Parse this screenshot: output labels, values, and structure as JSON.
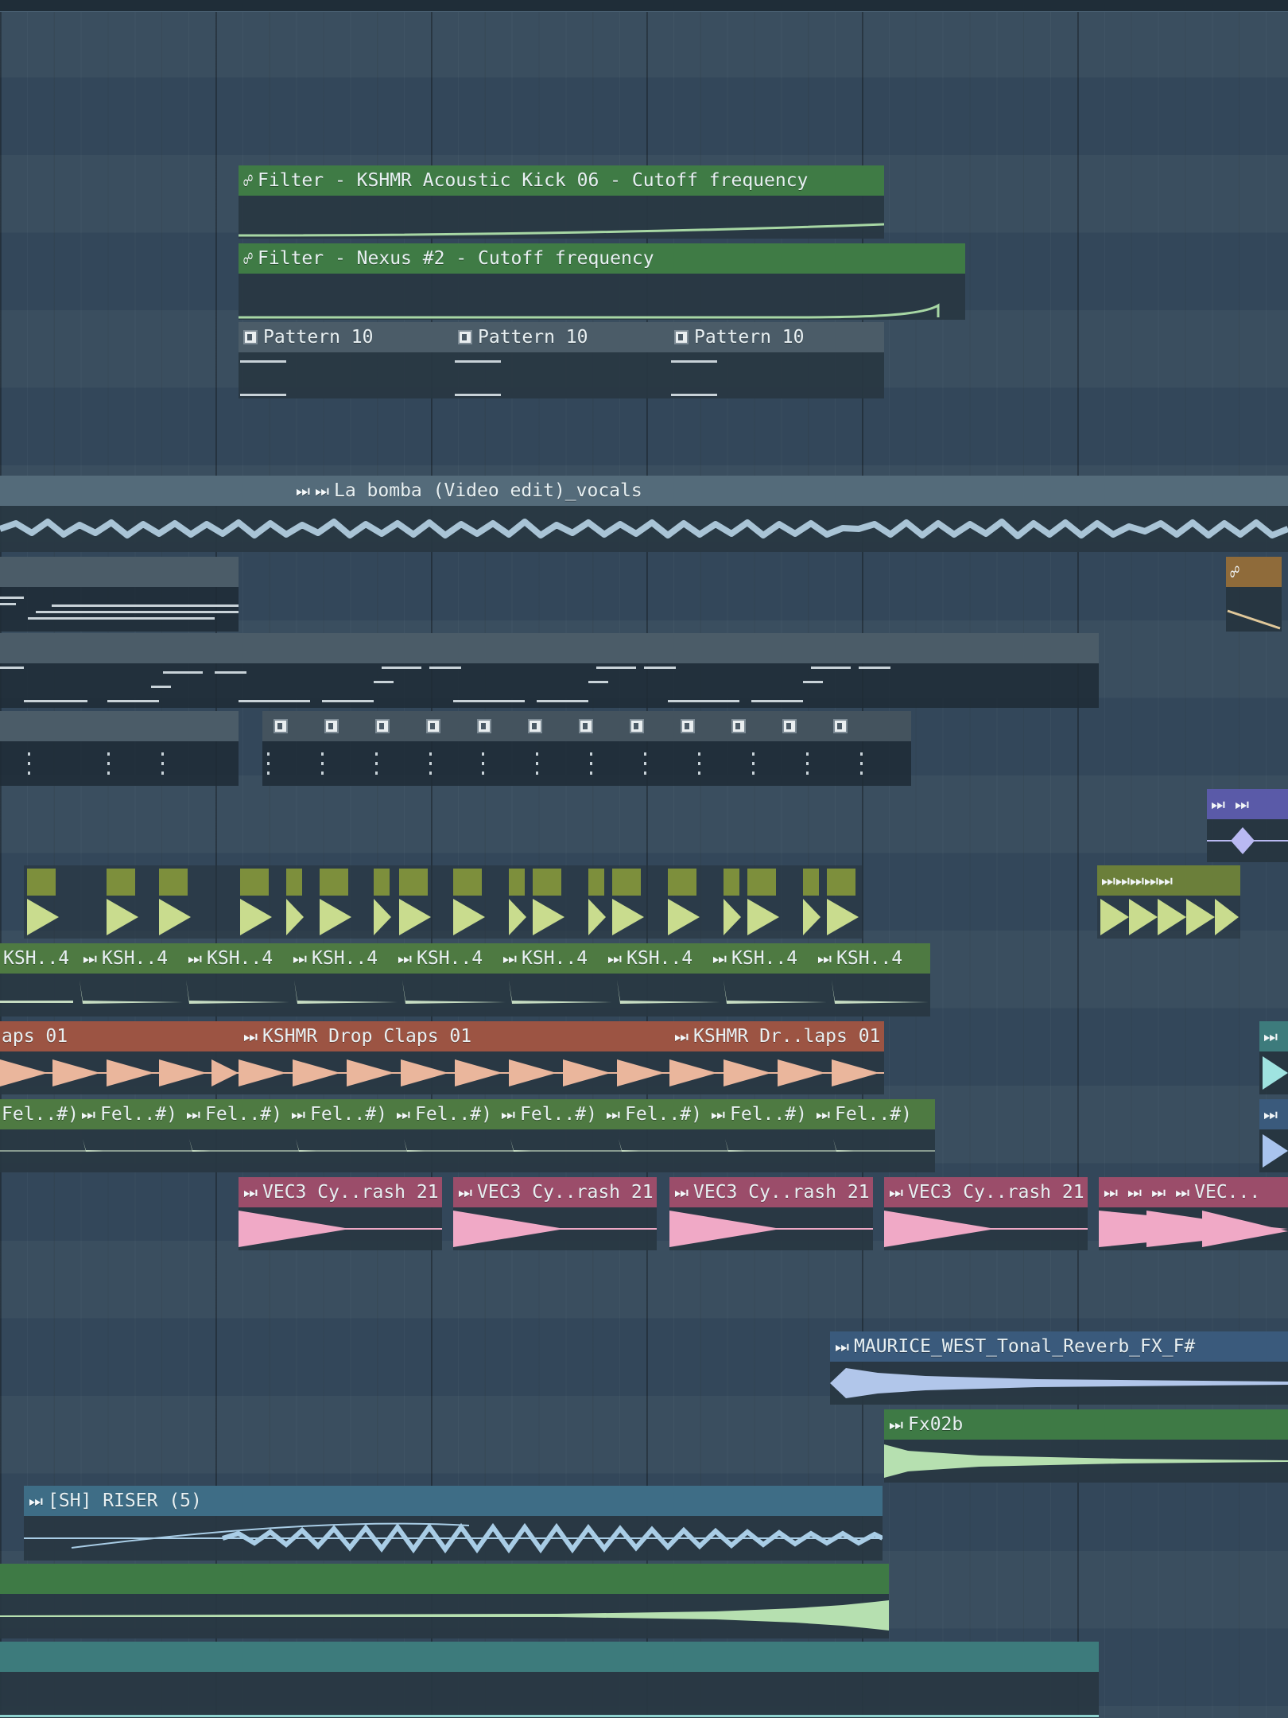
{
  "clips": {
    "filter_kick": "Filter - KSHMR Acoustic Kick 06 - Cutoff frequency",
    "filter_nexus": "Filter - Nexus #2 - Cutoff frequency",
    "pattern10_a": "Pattern 10",
    "pattern10_b": "Pattern 10",
    "pattern10_c": "Pattern 10",
    "vocals": "La bomba (Video edit)_vocals",
    "ksh_short": "KSH..4",
    "claps_left": "aps 01",
    "claps_mid": "KSHMR Drop Claps 01",
    "claps_right": "KSHMR Dr..laps 01",
    "fel": "Fel..#)",
    "vec_crash": "VEC3 Cy..rash 21",
    "vec_tail": "VEC...",
    "maurice": "MAURICE_WEST_Tonal_Reverb_FX_F#",
    "fx02b": "Fx02b",
    "riser": "[SH] RISER (5)"
  },
  "icons": {
    "automation": "automation-icon",
    "audio": "audio-clip-icon",
    "pattern": "pattern-icon"
  },
  "colors": {
    "background": "#34495a",
    "automation_green": "#3f7b45",
    "claps": "#9c5443",
    "crash": "#9b4d6a",
    "riser": "#3e6d86",
    "purple": "#5a5aa8"
  }
}
